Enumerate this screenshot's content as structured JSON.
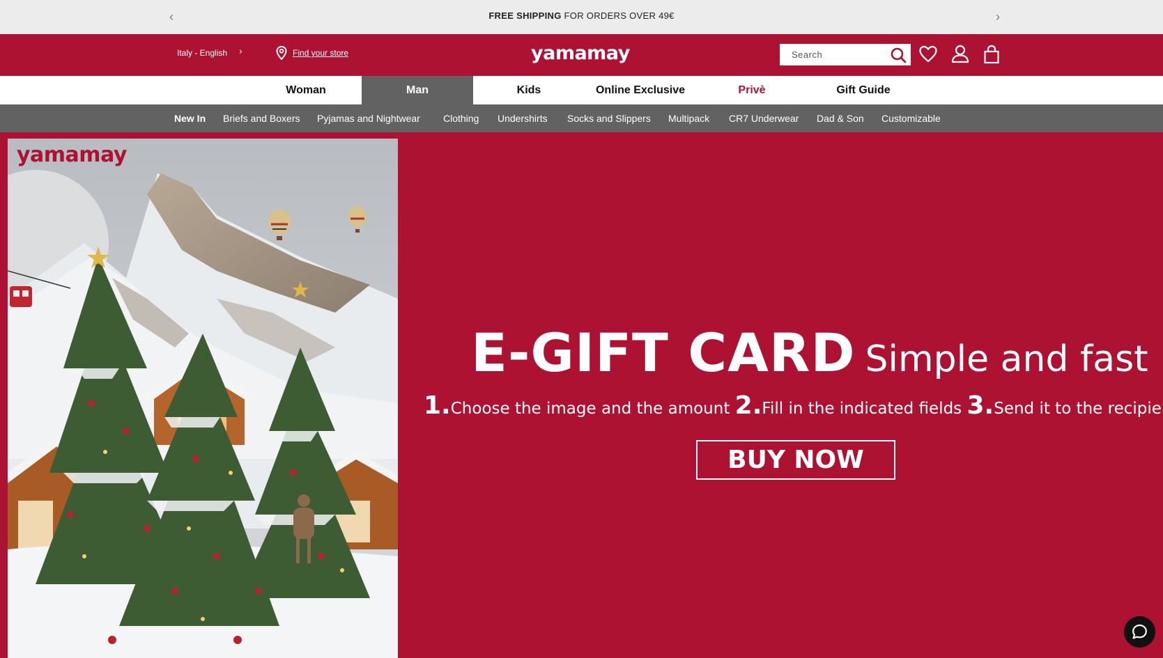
{
  "promo": {
    "bold": "FREE SHIPPING",
    "text": " FOR ORDERS OVER 49€"
  },
  "header": {
    "locale": "Italy - English",
    "store_link": "Find your store",
    "logo": "yamamay",
    "search_placeholder": "Search",
    "brand_color": "#ad1233"
  },
  "categories": [
    {
      "label": "Woman"
    },
    {
      "label": "Man",
      "active": true
    },
    {
      "label": "Kids"
    },
    {
      "label": "Online Exclusive"
    },
    {
      "label": "Privè"
    },
    {
      "label": "Gift Guide"
    }
  ],
  "subnav": [
    {
      "label": "New In"
    },
    {
      "label": "Briefs and Boxers"
    },
    {
      "label": "Pyjamas and Nightwear"
    },
    {
      "label": "Clothing"
    },
    {
      "label": "Undershirts"
    },
    {
      "label": "Socks and Slippers"
    },
    {
      "label": "Multipack"
    },
    {
      "label": "CR7 Underwear"
    },
    {
      "label": "Dad & Son"
    },
    {
      "label": "Customizable"
    }
  ],
  "hero": {
    "image_brand": "yamamay",
    "title": "E-GIFT CARD",
    "subtitle": "Simple and fast",
    "steps": [
      {
        "num": "1.",
        "text": "Choose the image and the amount"
      },
      {
        "num": "2.",
        "text": "Fill in the indicated fields"
      },
      {
        "num": "3.",
        "text": "Send it to the recipient"
      }
    ],
    "cta": "BUY NOW"
  }
}
